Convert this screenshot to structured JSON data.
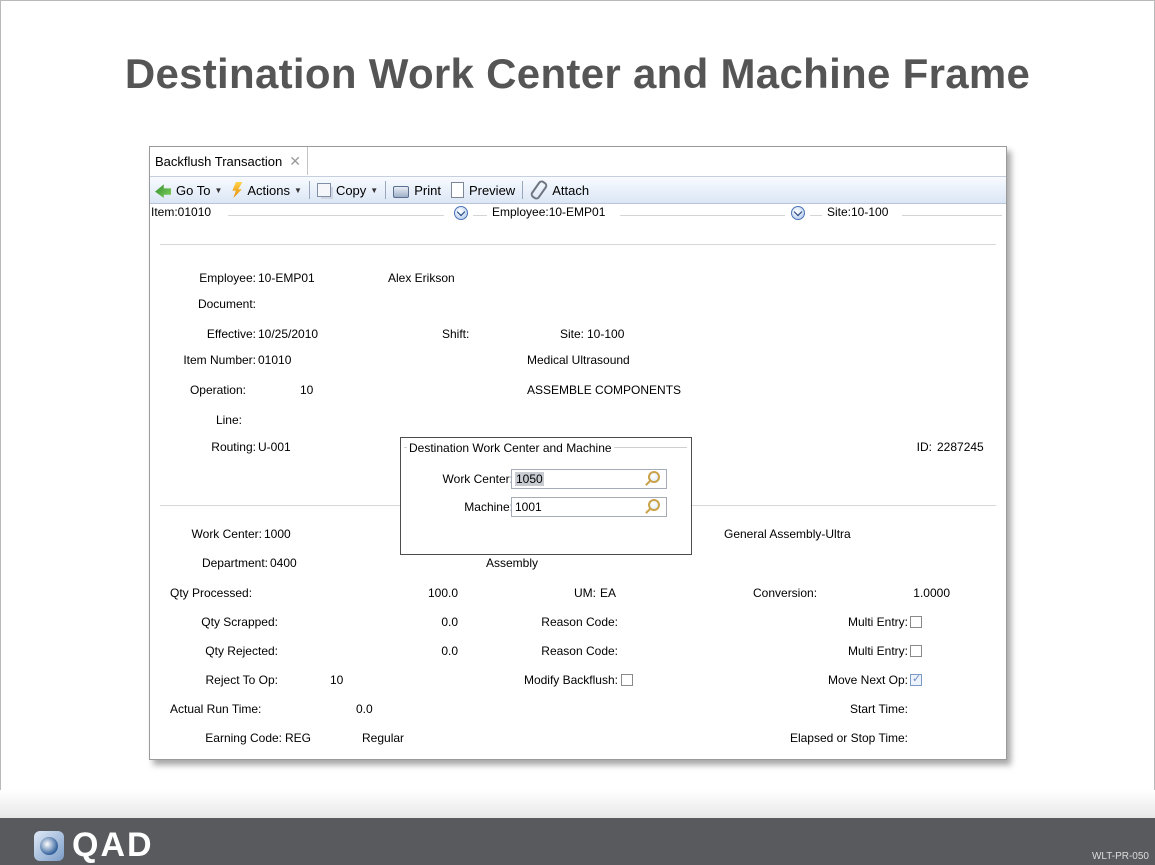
{
  "slide": {
    "title": "Destination Work Center and Machine Frame",
    "logo_text": "QAD",
    "slide_code": "WLT-PR-050"
  },
  "window": {
    "tab_label": "Backflush Transaction",
    "toolbar": {
      "goto": "Go To",
      "actions": "Actions",
      "copy": "Copy",
      "print": "Print",
      "preview": "Preview",
      "attach": "Attach"
    },
    "header": {
      "item": "Item:01010",
      "employee": "Employee:10-EMP01",
      "site": "Site:10-100"
    }
  },
  "form": {
    "employee_label": "Employee:",
    "employee_value": "10-EMP01",
    "employee_name": "Alex Erikson",
    "document_label": "Document:",
    "effective_label": "Effective:",
    "effective_value": "10/25/2010",
    "shift_label": "Shift:",
    "site_label": "Site:",
    "site_value": "10-100",
    "item_number_label": "Item Number:",
    "item_number_value": "01010",
    "item_desc": "Medical Ultrasound",
    "operation_label": "Operation:",
    "operation_value": "10",
    "operation_desc": "ASSEMBLE COMPONENTS",
    "line_label": "Line:",
    "routing_label": "Routing:",
    "routing_value": "U-001",
    "id_label": "ID:",
    "id_value": "2287245",
    "work_center_label": "Work Center:",
    "work_center_value": "1000",
    "work_center_desc": "General Assembly-Ultra",
    "department_label": "Department:",
    "department_value": "0400",
    "department_desc": "Assembly",
    "qty_processed_label": "Qty Processed:",
    "qty_processed_value": "100.0",
    "um_label": "UM:",
    "um_value": "EA",
    "conversion_label": "Conversion:",
    "conversion_value": "1.0000",
    "qty_scrapped_label": "Qty Scrapped:",
    "qty_scrapped_value": "0.0",
    "reason_code_label": "Reason Code:",
    "multi_entry_label": "Multi Entry:",
    "qty_rejected_label": "Qty Rejected:",
    "qty_rejected_value": "0.0",
    "reject_to_op_label": "Reject To Op:",
    "reject_to_op_value": "10",
    "modify_backflush_label": "Modify Backflush:",
    "move_next_op_label": "Move Next Op:",
    "actual_run_time_label": "Actual Run Time:",
    "actual_run_time_value": "0.0",
    "start_time_label": "Start Time:",
    "earning_code_label": "Earning Code:",
    "earning_code_value": "REG",
    "earning_code_desc": "Regular",
    "elapsed_label": "Elapsed or Stop Time:"
  },
  "dest_frame": {
    "title": "Destination Work Center and Machine",
    "work_center_label": "Work Center:",
    "work_center_value": "1050",
    "machine_label": "Machine:",
    "machine_value": "1001"
  }
}
